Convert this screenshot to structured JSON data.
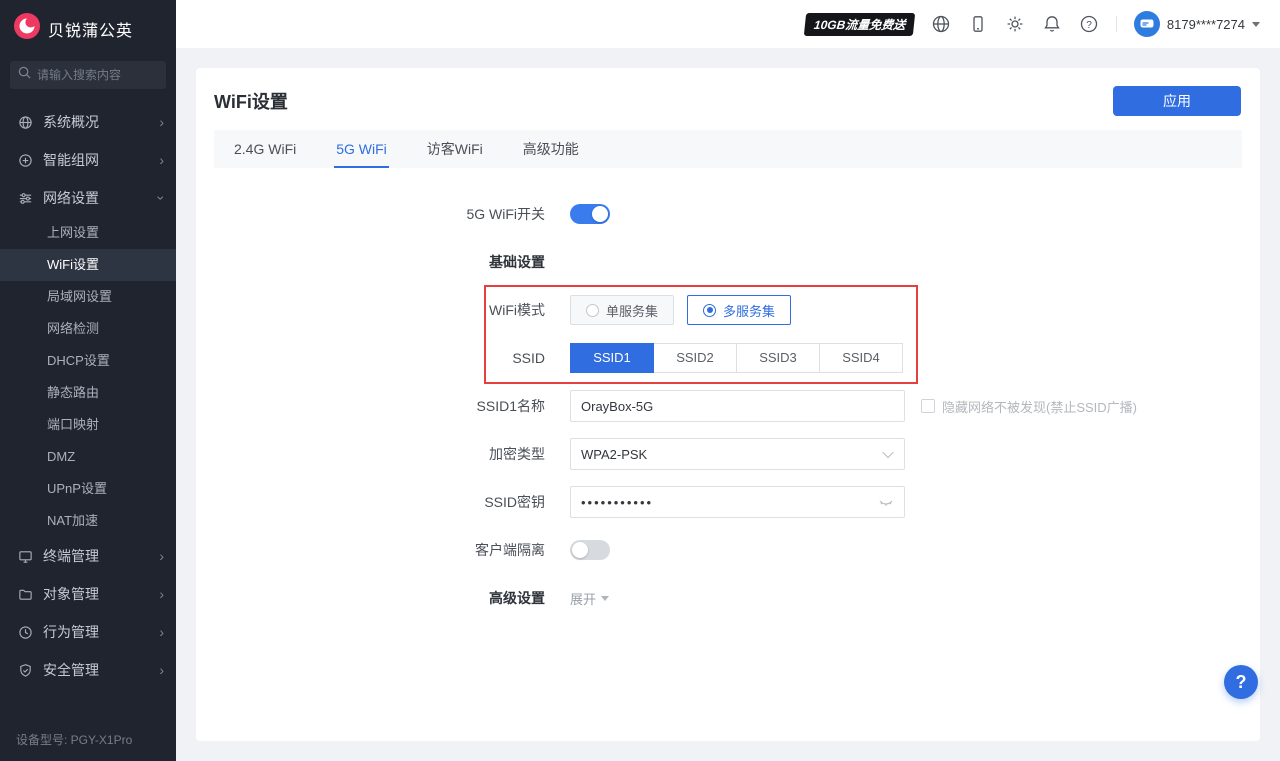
{
  "brand": {
    "name": "贝锐蒲公英"
  },
  "sidebar": {
    "search_placeholder": "请输入搜索内容",
    "items": [
      {
        "label": "系统概况"
      },
      {
        "label": "智能组网"
      },
      {
        "label": "网络设置",
        "children": [
          "上网设置",
          "WiFi设置",
          "局域网设置",
          "网络检测",
          "DHCP设置",
          "静态路由",
          "端口映射",
          "DMZ",
          "UPnP设置",
          "NAT加速"
        ]
      },
      {
        "label": "终端管理"
      },
      {
        "label": "对象管理"
      },
      {
        "label": "行为管理"
      },
      {
        "label": "安全管理"
      }
    ],
    "active_child": "WiFi设置",
    "device_model_label": "设备型号: PGY-X1Pro"
  },
  "topbar": {
    "promo": "10GB流量免费送",
    "account": "8179****7274"
  },
  "page": {
    "title": "WiFi设置",
    "apply": "应用",
    "tabs": [
      "2.4G WiFi",
      "5G WiFi",
      "访客WiFi",
      "高级功能"
    ],
    "active_tab": "5G WiFi"
  },
  "form": {
    "wifi_switch_label": "5G WiFi开关",
    "wifi_switch_state": "on",
    "basic_section": "基础设置",
    "wifi_mode_label": "WiFi模式",
    "wifi_mode_options": [
      "单服务集",
      "多服务集"
    ],
    "wifi_mode_selected": "多服务集",
    "ssid_label": "SSID",
    "ssid_options": [
      "SSID1",
      "SSID2",
      "SSID3",
      "SSID4"
    ],
    "ssid_selected": "SSID1",
    "ssid_name_label": "SSID1名称",
    "ssid_name_value": "OrayBox-5G",
    "hide_ssid_label": "隐藏网络不被发现(禁止SSID广播)",
    "hide_ssid_checked": false,
    "encryption_label": "加密类型",
    "encryption_value": "WPA2-PSK",
    "password_label": "SSID密钥",
    "password_value": "•••••••••••",
    "client_isolation_label": "客户端隔离",
    "client_isolation_state": "off",
    "advanced_label": "高级设置",
    "expand_label": "展开"
  }
}
